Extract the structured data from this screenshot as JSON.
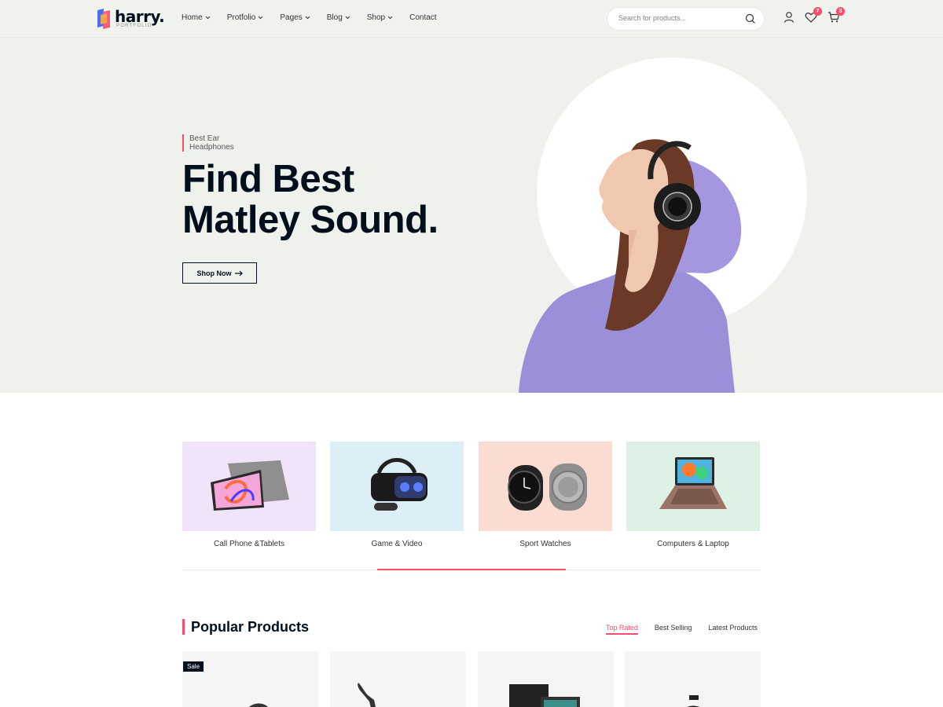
{
  "brand": {
    "name": "harry.",
    "tagline": "PORTFOLIO"
  },
  "nav": {
    "items": [
      {
        "label": "Home",
        "dropdown": true
      },
      {
        "label": "Protfolio",
        "dropdown": true
      },
      {
        "label": "Pages",
        "dropdown": true
      },
      {
        "label": "Blog",
        "dropdown": true
      },
      {
        "label": "Shop",
        "dropdown": true
      },
      {
        "label": "Contact",
        "dropdown": false
      }
    ]
  },
  "search": {
    "placeholder": "Search for products..."
  },
  "header_icons": {
    "wishlist_count": "7",
    "cart_count": "3"
  },
  "hero": {
    "subtitle": "Best Ear Headphones",
    "title_line1": "Find Best",
    "title_line2": "Matley Sound.",
    "button_label": "Shop Now"
  },
  "categories": [
    {
      "label": "Call Phone &Tablets",
      "bg": "#f1e4f9"
    },
    {
      "label": "Game & Video",
      "bg": "#ddeff6"
    },
    {
      "label": "Sport Watches",
      "bg": "#fadcd2"
    },
    {
      "label": "Computers & Laptop",
      "bg": "#ddf2e4"
    }
  ],
  "popular": {
    "title": "Popular Products",
    "tabs": [
      "Top Rated",
      "Best Selling",
      "Latest Products"
    ],
    "active_tab": "Top Rated",
    "sale_badge": "Sale"
  },
  "colors": {
    "accent": "#fd4b6b",
    "dark": "#010f1c",
    "hero_bg": "#eff1ed"
  }
}
